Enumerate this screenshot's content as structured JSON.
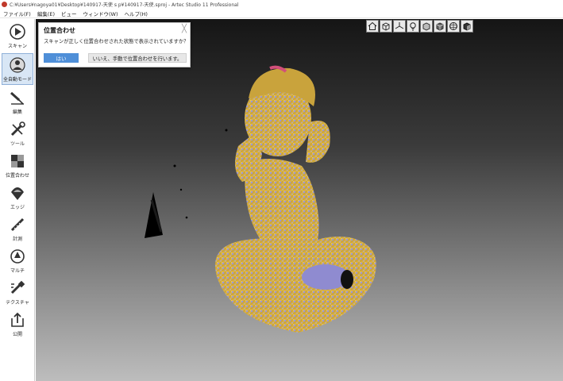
{
  "window": {
    "title": "C:¥Users¥nagoya01¥Desktop¥140917-天使 s p¥140917-天使.sproj - Artec Studio 11 Professional"
  },
  "menu": {
    "items": [
      "ファイル(F)",
      "編集(E)",
      "ビュー",
      "ウィンドウ(W)",
      "ヘルプ(H)"
    ]
  },
  "sidebar": {
    "items": [
      {
        "label": "スキャン",
        "icon": "play-icon"
      },
      {
        "label": "全自動モード",
        "icon": "autopilot-icon"
      },
      {
        "label": "編集",
        "icon": "eraser-icon"
      },
      {
        "label": "ツール",
        "icon": "tools-icon"
      },
      {
        "label": "位置合わせ",
        "icon": "align-icon"
      },
      {
        "label": "エッジ",
        "icon": "edge-icon"
      },
      {
        "label": "計測",
        "icon": "measure-icon"
      },
      {
        "label": "マルチ",
        "icon": "multi-icon"
      },
      {
        "label": "テクスチャ",
        "icon": "texture-icon"
      },
      {
        "label": "公開",
        "icon": "publish-icon"
      }
    ]
  },
  "dialog": {
    "title": "位置合わせ",
    "message": "スキャンが正しく位置合わせされた状態で表示されていますか？",
    "yes_label": "はい",
    "no_label": "いいえ、手動で位置合わせを行います。",
    "close_glyph": "╳"
  },
  "viewbar": {
    "icons": [
      "home-icon",
      "view-cube-icon",
      "axes-icon",
      "light-icon",
      "box-icon",
      "cube-solid-icon",
      "sphere-icon",
      "cube-shaded-icon"
    ]
  }
}
